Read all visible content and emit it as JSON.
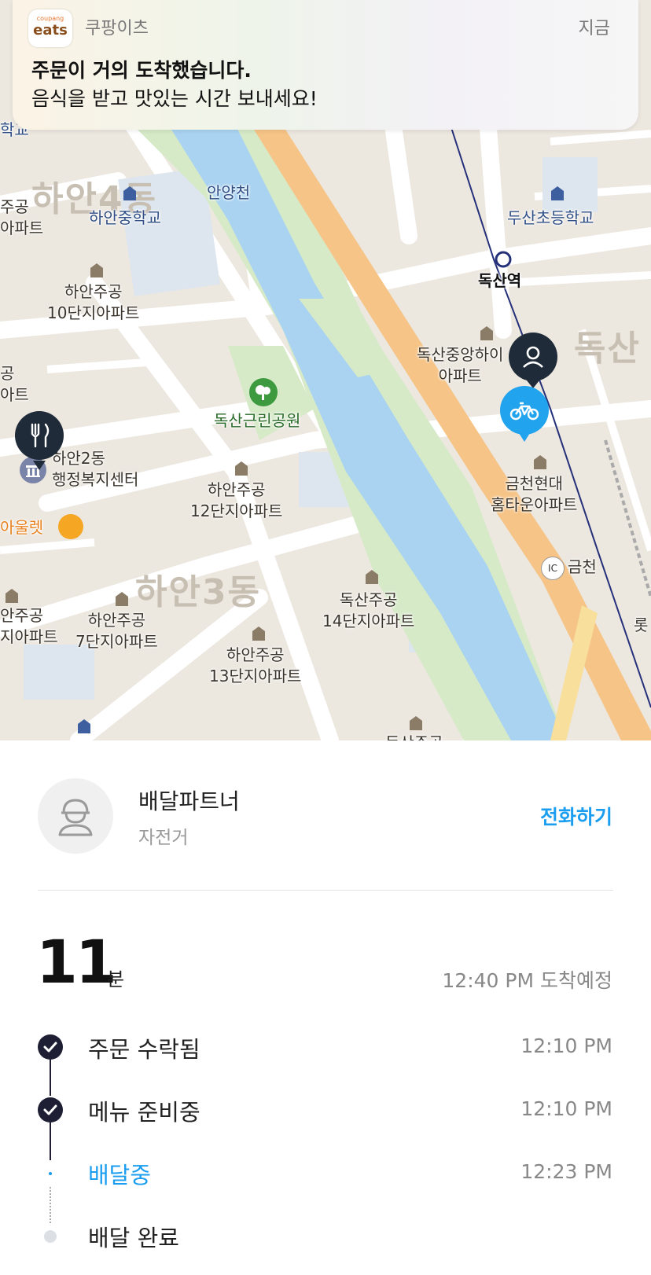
{
  "notification": {
    "app_logo_small": "coupang",
    "app_logo_main": "eats",
    "app_name": "쿠팡이츠",
    "time": "지금",
    "title": "주문이 거의 도착했습니다.",
    "body": "음식을 받고 맛있는 시간 보내세요!"
  },
  "map": {
    "labels": {
      "school_top_left": "학교",
      "apt_left_1": "주공\n아파트",
      "hanan_district_big": "하안4동",
      "hanan_middle_school": "하안중학교",
      "anyang_stream": "안양천",
      "dusan_elementary": "두산초등학교",
      "doksan_station": "독산역",
      "hanan_10": "하안주공\n10단지아파트",
      "doksan_apt": "독산중앙하이\n아파트",
      "doksan_big": "독산",
      "left_edge_1": "공\n아트",
      "park": "독산근린공원",
      "hanan2_center": "하안2동\n행정복지센터",
      "hanan_12": "하안주공\n12단지아파트",
      "geumcheon_hyundai": "금천현대\n홈타운아파트",
      "outlet": "아울렛",
      "geumcheon_ic": "금천",
      "ic_badge": "IC",
      "hanan3_big": "하안3동",
      "doksan_14": "독산주공\n14단지아파트",
      "apt_left_2": "안주공\n지아파트",
      "hanan_7": "하안주공\n7단지아파트",
      "hanan_13": "하안주공\n13단지아파트",
      "lotte_partial": "롯",
      "doksan_partial": "독산주공"
    },
    "icons": {
      "restaurant_pin": "fork-knife-icon",
      "person_pin": "person-icon",
      "rider_pin": "bicycle-icon"
    },
    "colors": {
      "road_orange": "#f6c486",
      "river": "#a9d3f1",
      "park_green": "#d6eac8",
      "rider_blue": "#22a3ee",
      "pin_dark": "#1f2b38"
    }
  },
  "partner": {
    "name": "배달파트너",
    "vehicle": "자전거",
    "call_label": "전화하기"
  },
  "eta": {
    "minutes": "11",
    "unit": "분",
    "arrival": "12:40 PM 도착예정"
  },
  "steps": [
    {
      "label": "주문 수락됨",
      "time": "12:10 PM",
      "state": "done"
    },
    {
      "label": "메뉴 준비중",
      "time": "12:10 PM",
      "state": "done"
    },
    {
      "label": "배달중",
      "time": "12:23 PM",
      "state": "active"
    },
    {
      "label": "배달 완료",
      "time": "",
      "state": "pending"
    }
  ],
  "accent_color": "#1b9ef0"
}
